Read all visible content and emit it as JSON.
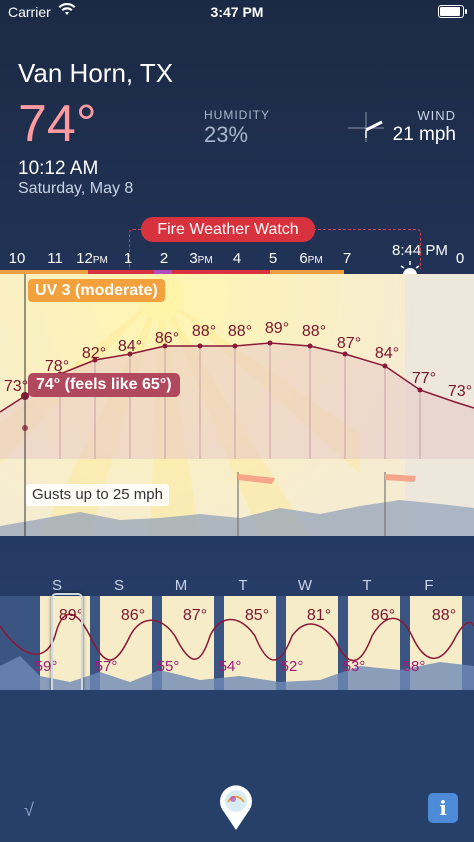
{
  "status_bar": {
    "carrier": "Carrier",
    "time": "3:47 PM"
  },
  "current": {
    "location": "Van Horn, TX",
    "temperature": "74°",
    "time": "10:12 AM",
    "date": "Saturday, May 8",
    "humidity_label": "HUMIDITY",
    "humidity_value": "23%",
    "wind_label": "WIND",
    "wind_value": "21 mph"
  },
  "alert": {
    "label": "Fire Weather Watch",
    "color": "#d8323e"
  },
  "hourly": {
    "hours": [
      {
        "h": "10",
        "ampm": ""
      },
      {
        "h": "11",
        "ampm": ""
      },
      {
        "h": "12",
        "ampm": "PM"
      },
      {
        "h": "1",
        "ampm": ""
      },
      {
        "h": "2",
        "ampm": ""
      },
      {
        "h": "3",
        "ampm": "PM"
      },
      {
        "h": "4",
        "ampm": ""
      },
      {
        "h": "5",
        "ampm": ""
      },
      {
        "h": "6",
        "ampm": "PM"
      },
      {
        "h": "7",
        "ampm": ""
      },
      {
        "h": "8",
        "ampm": ""
      },
      {
        "h": "0",
        "ampm": ""
      }
    ],
    "sunset": "8:44 PM",
    "uv_badge": "UV 3 (moderate)",
    "feels_badge": "74° (feels like 65°)",
    "gusts": "Gusts up to 25 mph",
    "temps": [
      "73°",
      "78°",
      "82°",
      "84°",
      "86°",
      "88°",
      "88°",
      "89°",
      "88°",
      "87°",
      "84°",
      "77°",
      "73°"
    ]
  },
  "weekly": {
    "days": [
      "S",
      "S",
      "M",
      "T",
      "W",
      "T",
      "F"
    ],
    "highs": [
      "89°",
      "86°",
      "87°",
      "85°",
      "81°",
      "86°",
      "88°"
    ],
    "lows": [
      "59°",
      "57°",
      "55°",
      "54°",
      "52°",
      "53°",
      "58°"
    ]
  },
  "toolbar": {
    "check": "√",
    "info": "i"
  },
  "colors": {
    "temp_accent": "#ff9aa0",
    "alert": "#d8323e",
    "uv": "#f2a13c",
    "info_button": "#4d8ad8"
  }
}
